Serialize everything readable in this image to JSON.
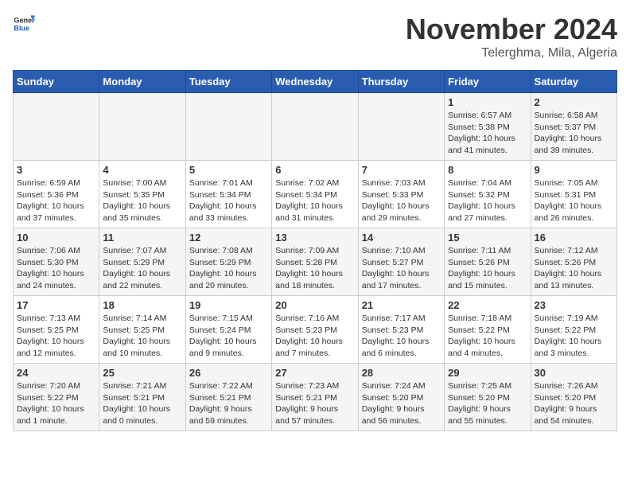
{
  "header": {
    "logo_general": "General",
    "logo_blue": "Blue",
    "month": "November 2024",
    "location": "Telerghma, Mila, Algeria"
  },
  "weekdays": [
    "Sunday",
    "Monday",
    "Tuesday",
    "Wednesday",
    "Thursday",
    "Friday",
    "Saturday"
  ],
  "weeks": [
    [
      {
        "day": "",
        "info": ""
      },
      {
        "day": "",
        "info": ""
      },
      {
        "day": "",
        "info": ""
      },
      {
        "day": "",
        "info": ""
      },
      {
        "day": "",
        "info": ""
      },
      {
        "day": "1",
        "info": "Sunrise: 6:57 AM\nSunset: 5:38 PM\nDaylight: 10 hours\nand 41 minutes."
      },
      {
        "day": "2",
        "info": "Sunrise: 6:58 AM\nSunset: 5:37 PM\nDaylight: 10 hours\nand 39 minutes."
      }
    ],
    [
      {
        "day": "3",
        "info": "Sunrise: 6:59 AM\nSunset: 5:36 PM\nDaylight: 10 hours\nand 37 minutes."
      },
      {
        "day": "4",
        "info": "Sunrise: 7:00 AM\nSunset: 5:35 PM\nDaylight: 10 hours\nand 35 minutes."
      },
      {
        "day": "5",
        "info": "Sunrise: 7:01 AM\nSunset: 5:34 PM\nDaylight: 10 hours\nand 33 minutes."
      },
      {
        "day": "6",
        "info": "Sunrise: 7:02 AM\nSunset: 5:34 PM\nDaylight: 10 hours\nand 31 minutes."
      },
      {
        "day": "7",
        "info": "Sunrise: 7:03 AM\nSunset: 5:33 PM\nDaylight: 10 hours\nand 29 minutes."
      },
      {
        "day": "8",
        "info": "Sunrise: 7:04 AM\nSunset: 5:32 PM\nDaylight: 10 hours\nand 27 minutes."
      },
      {
        "day": "9",
        "info": "Sunrise: 7:05 AM\nSunset: 5:31 PM\nDaylight: 10 hours\nand 26 minutes."
      }
    ],
    [
      {
        "day": "10",
        "info": "Sunrise: 7:06 AM\nSunset: 5:30 PM\nDaylight: 10 hours\nand 24 minutes."
      },
      {
        "day": "11",
        "info": "Sunrise: 7:07 AM\nSunset: 5:29 PM\nDaylight: 10 hours\nand 22 minutes."
      },
      {
        "day": "12",
        "info": "Sunrise: 7:08 AM\nSunset: 5:29 PM\nDaylight: 10 hours\nand 20 minutes."
      },
      {
        "day": "13",
        "info": "Sunrise: 7:09 AM\nSunset: 5:28 PM\nDaylight: 10 hours\nand 18 minutes."
      },
      {
        "day": "14",
        "info": "Sunrise: 7:10 AM\nSunset: 5:27 PM\nDaylight: 10 hours\nand 17 minutes."
      },
      {
        "day": "15",
        "info": "Sunrise: 7:11 AM\nSunset: 5:26 PM\nDaylight: 10 hours\nand 15 minutes."
      },
      {
        "day": "16",
        "info": "Sunrise: 7:12 AM\nSunset: 5:26 PM\nDaylight: 10 hours\nand 13 minutes."
      }
    ],
    [
      {
        "day": "17",
        "info": "Sunrise: 7:13 AM\nSunset: 5:25 PM\nDaylight: 10 hours\nand 12 minutes."
      },
      {
        "day": "18",
        "info": "Sunrise: 7:14 AM\nSunset: 5:25 PM\nDaylight: 10 hours\nand 10 minutes."
      },
      {
        "day": "19",
        "info": "Sunrise: 7:15 AM\nSunset: 5:24 PM\nDaylight: 10 hours\nand 9 minutes."
      },
      {
        "day": "20",
        "info": "Sunrise: 7:16 AM\nSunset: 5:23 PM\nDaylight: 10 hours\nand 7 minutes."
      },
      {
        "day": "21",
        "info": "Sunrise: 7:17 AM\nSunset: 5:23 PM\nDaylight: 10 hours\nand 6 minutes."
      },
      {
        "day": "22",
        "info": "Sunrise: 7:18 AM\nSunset: 5:22 PM\nDaylight: 10 hours\nand 4 minutes."
      },
      {
        "day": "23",
        "info": "Sunrise: 7:19 AM\nSunset: 5:22 PM\nDaylight: 10 hours\nand 3 minutes."
      }
    ],
    [
      {
        "day": "24",
        "info": "Sunrise: 7:20 AM\nSunset: 5:22 PM\nDaylight: 10 hours\nand 1 minute."
      },
      {
        "day": "25",
        "info": "Sunrise: 7:21 AM\nSunset: 5:21 PM\nDaylight: 10 hours\nand 0 minutes."
      },
      {
        "day": "26",
        "info": "Sunrise: 7:22 AM\nSunset: 5:21 PM\nDaylight: 9 hours\nand 59 minutes."
      },
      {
        "day": "27",
        "info": "Sunrise: 7:23 AM\nSunset: 5:21 PM\nDaylight: 9 hours\nand 57 minutes."
      },
      {
        "day": "28",
        "info": "Sunrise: 7:24 AM\nSunset: 5:20 PM\nDaylight: 9 hours\nand 56 minutes."
      },
      {
        "day": "29",
        "info": "Sunrise: 7:25 AM\nSunset: 5:20 PM\nDaylight: 9 hours\nand 55 minutes."
      },
      {
        "day": "30",
        "info": "Sunrise: 7:26 AM\nSunset: 5:20 PM\nDaylight: 9 hours\nand 54 minutes."
      }
    ]
  ]
}
